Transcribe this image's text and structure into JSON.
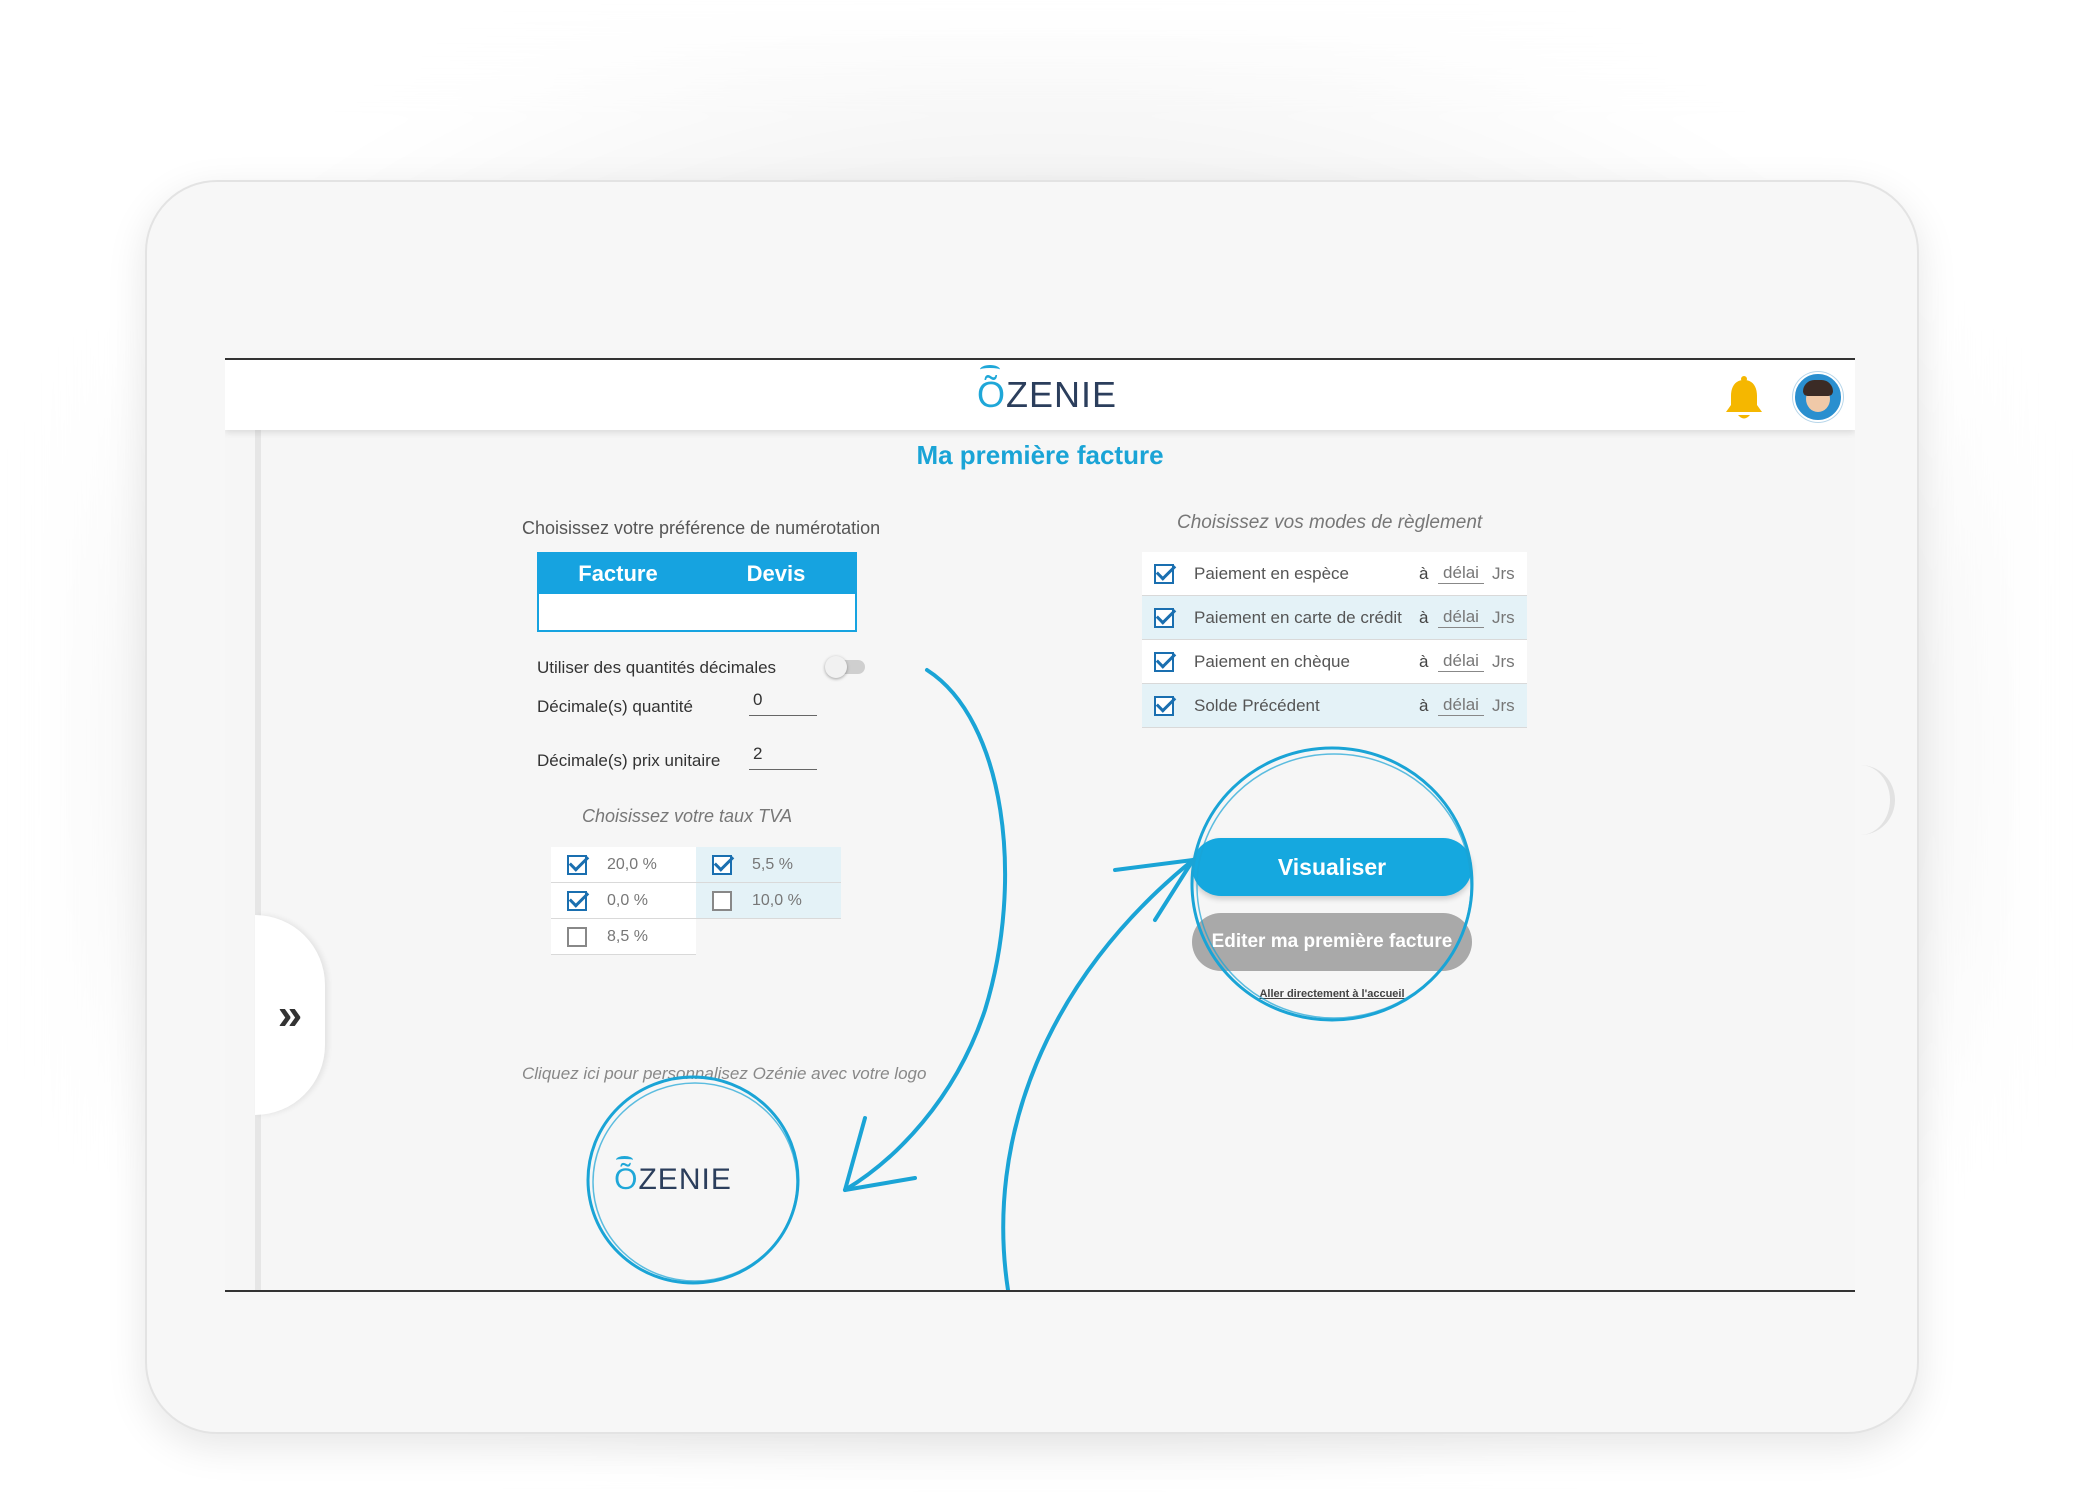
{
  "app": {
    "brand": "ZENIE",
    "brand_initial": "Õ"
  },
  "page": {
    "title": "Ma première facture"
  },
  "numbering": {
    "label": "Choisissez votre préférence de numérotation",
    "tabs": [
      {
        "label": "Facture"
      },
      {
        "label": "Devis"
      }
    ]
  },
  "decimals": {
    "toggle_label": "Utiliser des quantités décimales",
    "toggle_on": false,
    "quantity_label": "Décimale(s) quantité",
    "quantity_value": "0",
    "price_label": "Décimale(s) prix unitaire",
    "price_value": "2"
  },
  "tva": {
    "label": "Choisissez votre taux TVA",
    "rates": [
      {
        "label": "20,0 %",
        "checked": true
      },
      {
        "label": "5,5 %",
        "checked": true
      },
      {
        "label": "0,0 %",
        "checked": true
      },
      {
        "label": "10,0 %",
        "checked": false
      },
      {
        "label": "8,5 %",
        "checked": false
      }
    ]
  },
  "payment": {
    "label": "Choisissez vos modes de règlement",
    "a_label": "à",
    "delay_placeholder": "délai",
    "unit": "Jrs",
    "modes": [
      {
        "label": "Paiement en espèce",
        "checked": true
      },
      {
        "label": "Paiement en carte de crédit",
        "checked": true
      },
      {
        "label": "Paiement en chèque",
        "checked": true
      },
      {
        "label": "Solde Précédent",
        "checked": true
      }
    ]
  },
  "actions": {
    "preview_label": "Visualiser",
    "edit_label": "Editer ma première facture",
    "home_link": "Aller directement à l'accueil"
  },
  "logo": {
    "hint": "Cliquez ici pour personnalisez Ozénie avec votre logo",
    "brand": "ZENIE",
    "brand_initial": "Õ"
  },
  "sidebar": {
    "expand_label": "»"
  },
  "colors": {
    "accent": "#16a3e0",
    "title": "#1aa4d6",
    "secondary_button": "#a9a9a9"
  }
}
